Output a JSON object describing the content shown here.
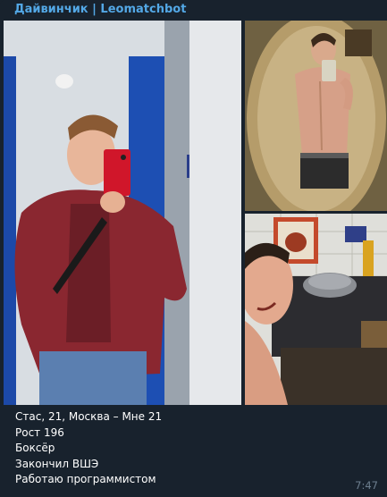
{
  "message": {
    "sender": "Дайвинчик | Leomatchbot",
    "caption_lines": [
      "Стас, 21, Москва – Мне 21",
      "Рост 196",
      "Боксёр",
      "Закончил ВШЭ",
      "Работаю программистом"
    ],
    "time": "7:47"
  },
  "colors": {
    "background": "#18222d",
    "sender": "#53a8e6",
    "text": "#ffffff",
    "time": "#6d7f8f"
  }
}
